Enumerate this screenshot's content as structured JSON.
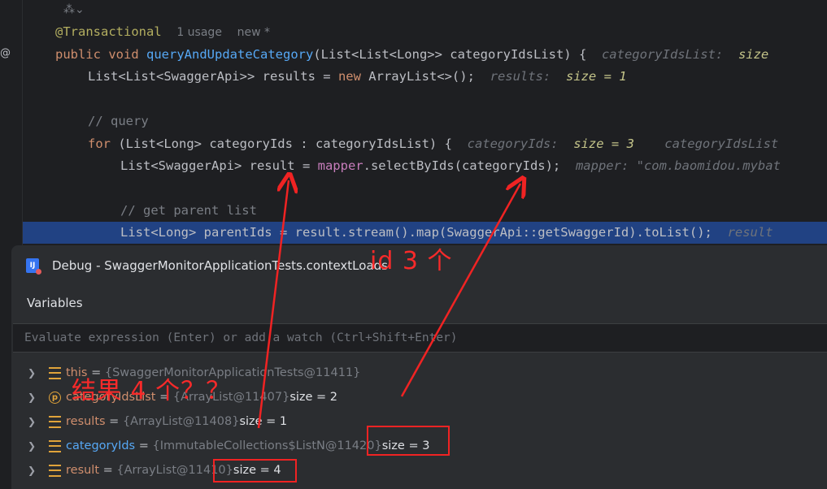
{
  "editor": {
    "top_lens": "⁂⌄",
    "annotation_line": {
      "annotation": "@Transactional",
      "usages": "1 usage",
      "author": "new *"
    },
    "method_line": {
      "kw_public": "public",
      "kw_void": "void",
      "name": "queryAndUpdateCategory",
      "signature": "(List<List<Long>> categoryIdsList) {",
      "hint_label": "categoryIdsList:",
      "hint_value": "size"
    },
    "results_line": {
      "code_a": "List<List<SwaggerApi>> results = ",
      "kw_new": "new",
      "code_b": " ArrayList<>();",
      "hint_label": "results:",
      "hint_value": "size = 1"
    },
    "comment_query": "// query",
    "for_line": {
      "kw_for": "for",
      "code": " (List<Long> categoryIds : categoryIdsList) {",
      "hint_a": "categoryIds:",
      "hint_a_value": "size = 3",
      "hint_b": "categoryIdsList"
    },
    "result_line": {
      "code_a": "List<SwaggerApi> result = ",
      "field": "mapper",
      "code_b": ".selectByIds(categoryIds);",
      "hint": "mapper: \"com.baomidou.mybat"
    },
    "comment_parent": "// get parent list",
    "parent_line": {
      "code_a": "List<Long> parentIds = result.stream().map(SwaggerApi::getSwaggerId).toList();",
      "hint": "result"
    }
  },
  "debug": {
    "title": "Debug - SwaggerMonitorApplicationTests.contextLoads",
    "tab": "Variables",
    "eval_placeholder": "Evaluate expression (Enter) or add a watch (Ctrl+Shift+Enter)",
    "vars": [
      {
        "name": "this",
        "ref": "{SwaggerMonitorApplicationTests@11411}",
        "size": "",
        "icon": "stack"
      },
      {
        "name": "categoryIdsList",
        "ref": "{ArrayList@11407}",
        "size": "size = 2",
        "icon": "param"
      },
      {
        "name": "results",
        "ref": "{ArrayList@11408}",
        "size": "size = 1",
        "icon": "stack"
      },
      {
        "name": "categoryIds",
        "ref": "{ImmutableCollections$ListN@11420}",
        "size": "size = 3",
        "icon": "stack"
      },
      {
        "name": "result",
        "ref": "{ArrayList@11410}",
        "size": "size = 4",
        "icon": "stack"
      }
    ]
  },
  "annotations": {
    "ids_note": "id 3 个",
    "result_note": "结果 4 个？？"
  },
  "colors": {
    "annotation_red": "#f72a2a",
    "selection": "#214283",
    "keyword": "#cf8e6d",
    "function": "#56a8f5"
  }
}
